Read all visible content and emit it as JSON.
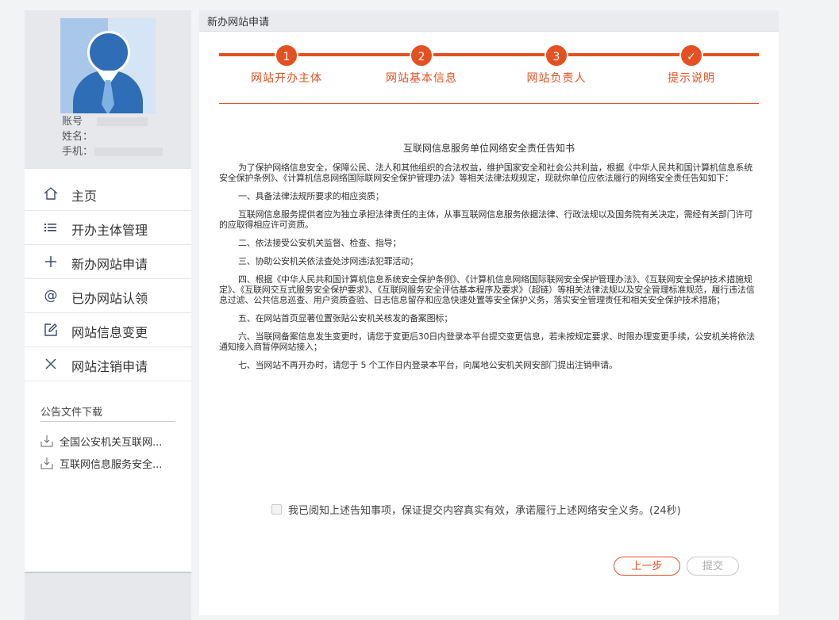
{
  "profile": {
    "account_label": "账号",
    "name_label": "姓名：",
    "phone_label": "手机："
  },
  "menu": [
    {
      "label": "主页",
      "icon": "home-icon"
    },
    {
      "label": "开办主体管理",
      "icon": "list-icon"
    },
    {
      "label": "新办网站申请",
      "icon": "plus-icon"
    },
    {
      "label": "已办网站认领",
      "icon": "at-icon"
    },
    {
      "label": "网站信息变更",
      "icon": "edit-icon"
    },
    {
      "label": "网站注销申请",
      "icon": "close-icon"
    }
  ],
  "downloads": {
    "title": "公告文件下载",
    "items": [
      "全国公安机关互联网...",
      "互联网信息服务安全..."
    ]
  },
  "main": {
    "header": "新办网站申请",
    "steps": [
      {
        "num": "1",
        "label": "网站开办主体"
      },
      {
        "num": "2",
        "label": "网站基本信息"
      },
      {
        "num": "3",
        "label": "网站负责人"
      },
      {
        "num": "✓",
        "label": "提示说明"
      }
    ],
    "doc_title": "互联网信息服务单位网络安全责任告知书",
    "paragraphs": [
      "为了保护网络信息安全，保障公民、法人和其他组织的合法权益，维护国家安全和社会公共利益，根据《中华人民共和国计算机信息系统安全保护条例》、《计算机信息网络国际联网安全保护管理办法》等相关法律法规规定，现就你单位应依法履行的网络安全责任告知如下：",
      "一、具备法律法规所要求的相应资质；",
      "互联网信息服务提供者应为独立承担法律责任的主体，从事互联网信息服务依据法律、行政法规以及国务院有关决定，需经有关部门许可的应取得相应许可资质。",
      "二、依法接受公安机关监督、检查、指导；",
      "三、协助公安机关依法查处涉网违法犯罪活动；",
      "四、根据《中华人民共和国计算机信息系统安全保护条例》、《计算机信息网络国际联网安全保护管理办法》、《互联网安全保护技术措施规定》、《互联网交互式服务安全保护要求》、《互联网服务安全评估基本程序及要求》（超链）等相关法律法规以及安全管理标准规范，履行违法信息过滤、公共信息巡查、用户资质查验、日志信息留存和应急快速处置等安全保护义务，落实安全管理责任和相关安全保护技术措施；",
      "五、在网站首页显著位置张贴公安机关核发的备案图标；",
      "六、当联网备案信息发生变更时，请您于变更后30日内登录本平台提交变更信息，若未按规定要求、时限办理变更手续，公安机关将依法通知接入商暂停网站接入；",
      "七、当网站不再开办时，请您于 5 个工作日内登录本平台，向属地公安机关网安部门提出注销申请。"
    ],
    "agree_text": "我已阅知上述告知事项，保证提交内容真实有效，承诺履行上述网络安全义务。(24秒)",
    "prev_button": "上一步",
    "submit_button": "提交"
  },
  "colors": {
    "accent": "#e55022",
    "icon": "#3a4a6b",
    "avatar": "#2f6db6"
  }
}
